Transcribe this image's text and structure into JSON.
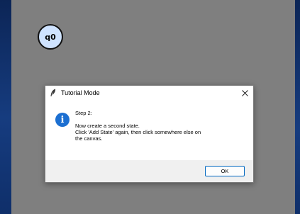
{
  "canvas": {
    "background": "#7f7f7f",
    "states": [
      {
        "label": "q0",
        "fill": "#cfe3ff"
      }
    ]
  },
  "dialog": {
    "title": "Tutorial Mode",
    "title_icon": "feather-icon",
    "close_icon": "close-icon",
    "info_icon": "info-icon",
    "info_glyph": "i",
    "step": "Step 2:",
    "message": "Now create a second state.\nClick 'Add State' again, then click somewhere else on the canvas.",
    "ok_label": "OK",
    "accent": "#0067c0",
    "info_color": "#1c6fd1"
  }
}
